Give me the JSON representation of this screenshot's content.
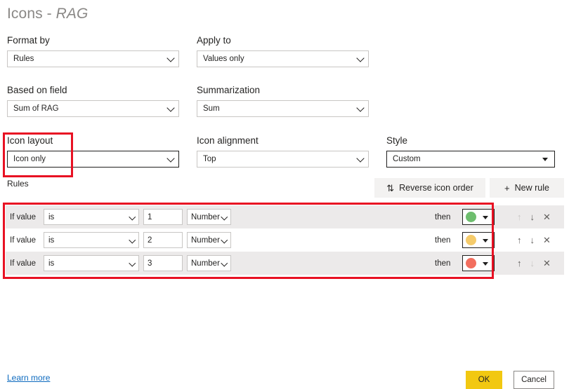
{
  "dialog": {
    "title_prefix": "Icons - ",
    "title_field": "RAG"
  },
  "fields": {
    "format_by": {
      "label": "Format by",
      "value": "Rules"
    },
    "apply_to": {
      "label": "Apply to",
      "value": "Values only"
    },
    "based_on_field": {
      "label": "Based on field",
      "value": "Sum of RAG"
    },
    "summarization": {
      "label": "Summarization",
      "value": "Sum"
    },
    "icon_layout": {
      "label": "Icon layout",
      "value": "Icon only"
    },
    "icon_alignment": {
      "label": "Icon alignment",
      "value": "Top"
    },
    "style": {
      "label": "Style",
      "value": "Custom"
    }
  },
  "rules_section": {
    "label": "Rules",
    "reverse_button": {
      "label": "Reverse icon order",
      "glyph": "⇅"
    },
    "new_rule_button": {
      "label": "New rule",
      "glyph": "+"
    },
    "if_value_label": "If value",
    "then_label": "then",
    "actions": {
      "move_up": "↑",
      "move_down": "↓",
      "remove": "✕"
    },
    "rows": [
      {
        "if_value": "If value",
        "operator": "is",
        "value": "1",
        "value_type": "Number",
        "then": "then",
        "icon_color": "#6EBE6E",
        "move_up_enabled": false,
        "move_down_enabled": true
      },
      {
        "if_value": "If value",
        "operator": "is",
        "value": "2",
        "value_type": "Number",
        "then": "then",
        "icon_color": "#F5CB6B",
        "move_up_enabled": true,
        "move_down_enabled": true
      },
      {
        "if_value": "If value",
        "operator": "is",
        "value": "3",
        "value_type": "Number",
        "then": "then",
        "icon_color": "#F26E5E",
        "move_up_enabled": true,
        "move_down_enabled": false
      }
    ]
  },
  "footer": {
    "learn_more": "Learn more",
    "ok": "OK",
    "cancel": "Cancel"
  },
  "colors": {
    "accent_ok": "#F2C811",
    "annotation": "#E81123",
    "link": "#0D6ABF"
  }
}
